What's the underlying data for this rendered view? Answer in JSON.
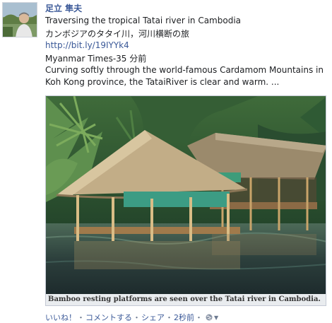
{
  "post": {
    "author": "足立 隼夫",
    "title_en": "Traversing the tropical Tatai river in Cambodia",
    "title_jp": "カンボジアのタタイ川，河川横断の旅",
    "link": "http://bit.ly/19IYYk4",
    "source": "Myanmar Times-35 分前",
    "description": "Curving softly through the world-famous Cardamom Mountains in Koh Kong province, the TataiRiver is clear and warm. ...",
    "photo_caption": "Bamboo resting platforms are seen over the Tatai river in Cambodia."
  },
  "actions": {
    "like": "いいね！",
    "comment": "コメントする",
    "share": "シェア",
    "time": "2秒前",
    "sep": "・",
    "privacy_icon": "globe-icon",
    "menu_icon": "caret-down-icon"
  },
  "colors": {
    "link": "#3b5998",
    "meta": "#6d7a90"
  }
}
